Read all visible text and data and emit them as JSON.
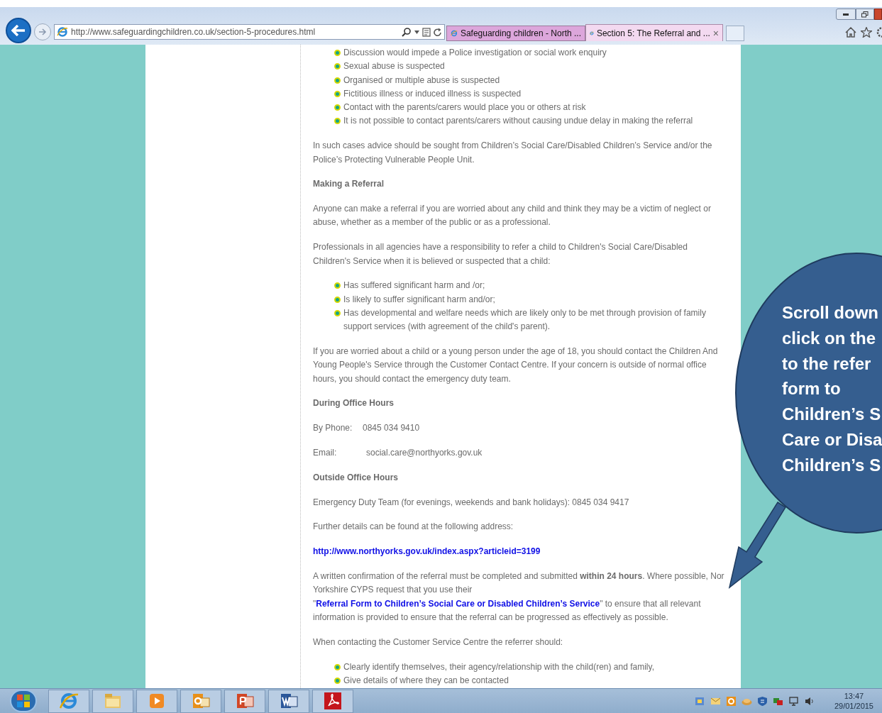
{
  "browser": {
    "address": "http://www.safeguardingchildren.co.uk/section-5-procedures.html",
    "tabs": [
      {
        "label": "Safeguarding children - North ...",
        "selected": false
      },
      {
        "label": "Section 5: The Referral and ...",
        "selected": true
      }
    ],
    "close_glyph": "×"
  },
  "content": [
    {
      "kind": "bullets",
      "items": [
        "Discussion would impede a Police investigation or social work enquiry",
        "Sexual abuse is suspected",
        "Organised or multiple abuse is suspected",
        "Fictitious illness or induced illness is suspected",
        "Contact with the parents/carers would place you or others at risk",
        "It is not possible to contact parents/carers without causing undue delay in making the referral"
      ]
    },
    {
      "kind": "paragraph",
      "text": "In such cases advice should be sought from Children’s Social Care/Disabled Children’s Service and/or the Police’s Protecting Vulnerable People Unit."
    },
    {
      "kind": "heading",
      "text": "Making a Referral"
    },
    {
      "kind": "paragraph",
      "text": "Anyone can make a referral if you are worried about any child and think they may be a victim of neglect or abuse, whether as a member of the public or as a professional."
    },
    {
      "kind": "paragraph",
      "text": "Professionals in all agencies have a responsibility to refer a child to Children's Social Care/Disabled Children's Service when it is believed or suspected that a child:"
    },
    {
      "kind": "bullets",
      "items": [
        "Has suffered significant harm and /or;",
        "Is likely to suffer significant harm and/or;",
        "Has developmental and welfare needs which are likely only to be met through provision of family support services (with agreement of the child's parent)."
      ]
    },
    {
      "kind": "paragraph",
      "text": "If you are worried about a child or a young person under the age of 18, you should contact the Children And Young People's Service through the Customer Contact Centre.  If your concern is outside of normal office hours, you should contact the emergency duty team."
    },
    {
      "kind": "heading",
      "text": "During Office Hours"
    },
    {
      "kind": "field",
      "label": "By Phone:",
      "value": "0845 034 9410"
    },
    {
      "kind": "field",
      "label": "Email:",
      "value": "social.care@northyorks.gov.uk"
    },
    {
      "kind": "heading",
      "text": "Outside Office Hours"
    },
    {
      "kind": "paragraph",
      "text": "Emergency Duty Team (for evenings, weekends and bank holidays): 0845 034 9417"
    },
    {
      "kind": "paragraph",
      "text": "Further details can be found at the following address:"
    },
    {
      "kind": "link",
      "text": "http://www.northyorks.gov.uk/index.aspx?articleid=3199"
    },
    {
      "kind": "mixed",
      "segments": [
        {
          "kind": "plain",
          "text": "A written confirmation of the referral must be completed and submitted "
        },
        {
          "kind": "bold",
          "text": "within 24 hours"
        },
        {
          "kind": "plain",
          "text": ".  Where possible, Nor"
        },
        {
          "kind": "break"
        },
        {
          "kind": "plain",
          "text": "Yorkshire CYPS request that you use their \""
        },
        {
          "kind": "link",
          "text": "Referral Form to Children’s Social Care or Disabled Children’s Service"
        },
        {
          "kind": "plain",
          "text": "\" to ensure that all relevant information is provided to ensure that the referral can be progressed as effectively as possible."
        }
      ]
    },
    {
      "kind": "paragraph",
      "text": "When contacting the Customer Service Centre the referrer should:"
    },
    {
      "kind": "bullets",
      "items": [
        "Clearly identify themselves, their agency/relationship with the child(ren) and family,",
        "Give details of where they can be contacted"
      ]
    }
  ],
  "callout": {
    "lines": [
      "Scroll down",
      "click on the",
      "to the refer",
      "form to",
      "Children’s S",
      "Care or Disa",
      "Children’s S"
    ]
  },
  "taskbar": {
    "time": "13:47",
    "date": "29/01/2015"
  }
}
